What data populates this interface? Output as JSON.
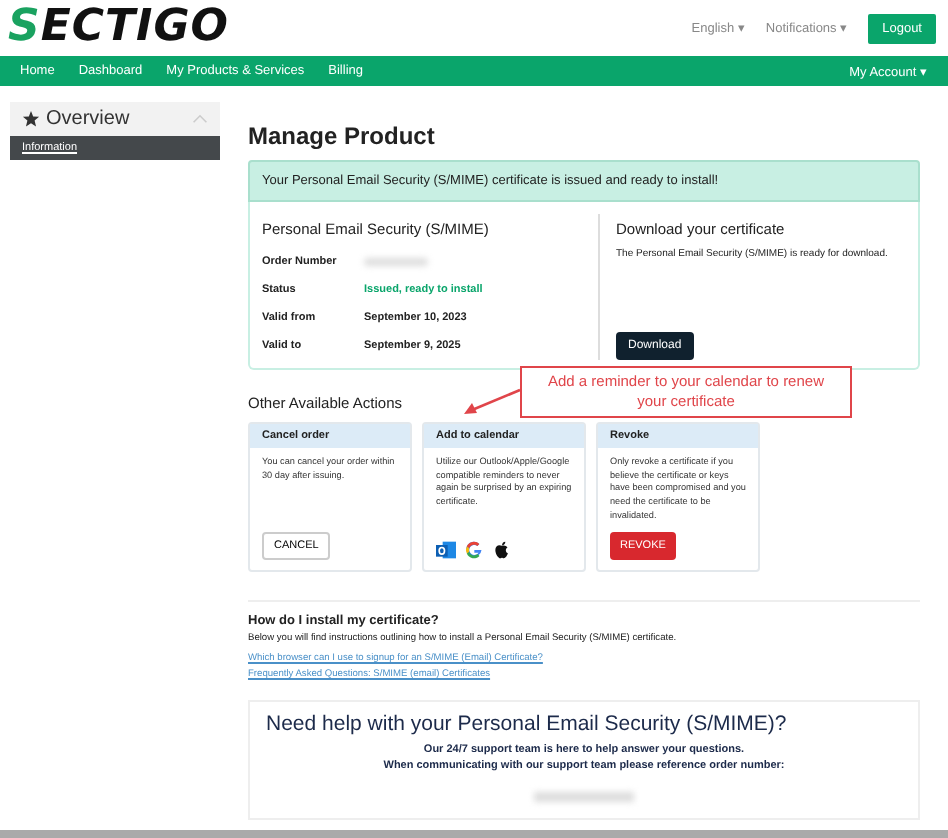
{
  "logo": {
    "text": "ECTIGO",
    "mark": "S"
  },
  "header_menu": [
    {
      "label": "English",
      "caret": "▾"
    },
    {
      "label": "Notifications",
      "caret": "▾"
    }
  ],
  "logout_button": "Logout",
  "nav": {
    "items": [
      "Home",
      "Dashboard",
      "My Products & Services",
      "Billing"
    ],
    "account": "My Account",
    "account_caret": "▾"
  },
  "sidebar": {
    "title": "Overview",
    "items": [
      {
        "label": "Information",
        "selected": true
      }
    ]
  },
  "page_title": "Manage Product",
  "alert": "Your Personal Email Security (S/MIME) certificate is issued and ready to install!",
  "product": {
    "title": "Personal Email Security (S/MIME)",
    "fields": [
      {
        "label": "Order Number",
        "kind": "redacted"
      },
      {
        "label": "Status",
        "value": "Issued, ready to install",
        "kind": "status"
      },
      {
        "label": "Valid from",
        "value": "September 10, 2023",
        "kind": "text"
      },
      {
        "label": "Valid to",
        "value": "September 9, 2025",
        "kind": "text"
      }
    ]
  },
  "download": {
    "title": "Download your certificate",
    "text": "The Personal Email Security (S/MIME) is ready for download.",
    "button": "Download"
  },
  "actions_title": "Other Available Actions",
  "annotation": "Add a reminder to your calendar to renew your certificate",
  "actions": [
    {
      "title": "Cancel order",
      "text": "You can cancel your order within 30 day after issuing.",
      "kind": "cancel",
      "button": "CANCEL"
    },
    {
      "title": "Add to calendar",
      "text": "Utilize our Outlook/Apple/Google compatible reminders to never again be surprised by an expiring certificate.",
      "kind": "calendar"
    },
    {
      "title": "Revoke",
      "text": "Only revoke a certificate if you believe the certificate or keys have been compromised and you need the certificate to be invalidated.",
      "kind": "revoke",
      "button": "REVOKE"
    }
  ],
  "install": {
    "title": "How do I install my certificate?",
    "text": "Below you will find instructions outlining how to install a Personal Email Security (S/MIME) certificate.",
    "links": [
      "Which browser can I use to signup for an S/MIME (Email) Certificate?",
      "Frequently Asked Questions: S/MIME (email) Certificates"
    ]
  },
  "help": {
    "title": "Need help with your Personal Email Security (S/MIME)?",
    "lines": [
      "Our 24/7 support team is here to help answer your questions.",
      "When communicating with our support team please reference order number:"
    ]
  }
}
